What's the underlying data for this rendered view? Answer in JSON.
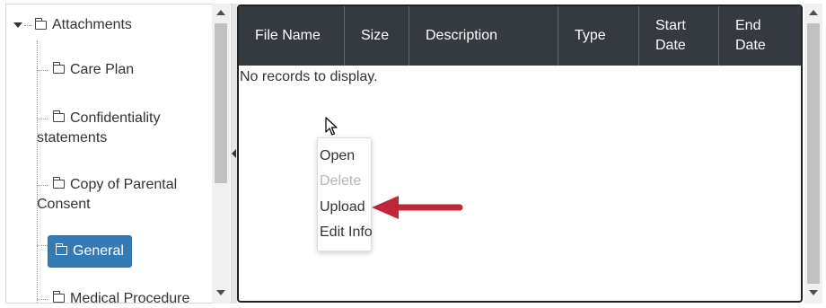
{
  "tree": {
    "root_label": "Attachments",
    "items": [
      {
        "label_lines": [
          "Care Plan"
        ]
      },
      {
        "label_lines": [
          "Confidentiality",
          "statements"
        ]
      },
      {
        "label_lines": [
          "Copy of Parental",
          "Consent"
        ]
      },
      {
        "label_lines": [
          "General"
        ],
        "selected": true
      },
      {
        "label_lines": [
          "Medical Procedure"
        ]
      }
    ]
  },
  "grid": {
    "columns": [
      {
        "label": "File Name"
      },
      {
        "label": "Size"
      },
      {
        "label": "Description"
      },
      {
        "label": "Type"
      },
      {
        "label_lines": [
          "Start",
          "Date"
        ]
      },
      {
        "label_lines": [
          "End",
          "Date"
        ]
      }
    ],
    "empty_message": "No records to display."
  },
  "context_menu": {
    "items": [
      {
        "label": "Open",
        "enabled": true
      },
      {
        "label": "Delete",
        "enabled": false
      },
      {
        "label": "Upload",
        "enabled": true
      },
      {
        "label": "Edit Info",
        "enabled": true
      }
    ]
  },
  "colors": {
    "selected_bg": "#337ab7",
    "header_bg": "#343a40",
    "annotation_arrow": "#c0263a"
  }
}
